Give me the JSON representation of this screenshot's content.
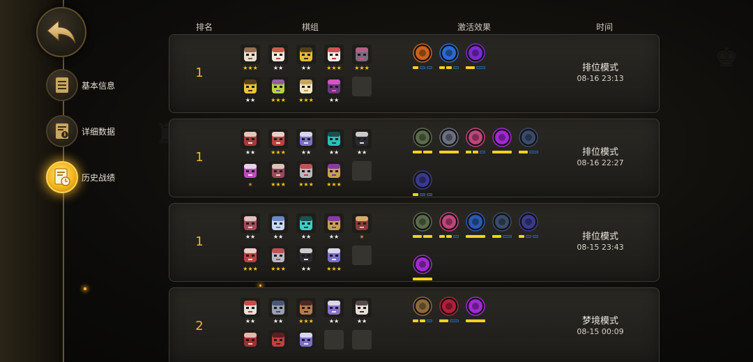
{
  "sidebar": {
    "back_icon": "back-arrow-icon",
    "items": [
      {
        "label": "基本信息",
        "icon": "document-icon"
      },
      {
        "label": "详细数据",
        "icon": "data-sheet-icon"
      },
      {
        "label": "历史战绩",
        "icon": "history-icon",
        "active": true
      }
    ]
  },
  "table": {
    "headers": {
      "rank": "排名",
      "pieces": "棋组",
      "synergy": "激活效果",
      "time": "时间"
    },
    "rows": [
      {
        "rank": "1",
        "mode": "排位模式",
        "date": "08-16 23:13",
        "pieces": [
          {
            "color": "#e8e0d0",
            "accent": "#8a5a3a",
            "stars": "★★★",
            "star_color": "gold"
          },
          {
            "color": "#f2ece0",
            "accent": "#c04830",
            "stars": "★★",
            "star_color": "white"
          },
          {
            "color": "#e9b93a",
            "accent": "#3a2a1a",
            "stars": "★★",
            "star_color": "white"
          },
          {
            "color": "#f0ece8",
            "accent": "#c83838",
            "stars": "★★★",
            "star_color": "gold"
          },
          {
            "color": "#7a6a7a",
            "accent": "#c05a8a",
            "stars": "★★★",
            "star_color": "gold"
          },
          {
            "color": "#f1c33a",
            "accent": "#3a2a1a",
            "stars": "★★",
            "star_color": "white"
          },
          {
            "color": "#b3d63a",
            "accent": "#8a4ab0",
            "stars": "★★★",
            "star_color": "gold"
          },
          {
            "color": "#f0e6c8",
            "accent": "#c09a48",
            "stars": "★★★",
            "star_color": "gold"
          },
          {
            "color": "#6a3a7a",
            "accent": "#e85ad0",
            "stars": "★★",
            "star_color": "white"
          },
          {
            "empty": true
          }
        ],
        "synergies": [
          {
            "icon": "feather-icon",
            "bg": "#c8621e",
            "level": 1,
            "max": 3
          },
          {
            "icon": "blue-feather-icon",
            "bg": "#2a6ad0",
            "level": 2,
            "max": 3
          },
          {
            "icon": "crescent-icon",
            "bg": "#7a2ad0",
            "level": 1,
            "max": 2
          }
        ]
      },
      {
        "rank": "1",
        "mode": "排位模式",
        "date": "08-16 22:27",
        "pieces": [
          {
            "color": "#a83a3a",
            "accent": "#f0e0d0",
            "stars": "★★",
            "star_color": "white"
          },
          {
            "color": "#c04040",
            "accent": "#f2e8e0",
            "stars": "★★★",
            "star_color": "gold"
          },
          {
            "color": "#7a70c8",
            "accent": "#e8e8f0",
            "stars": "★★",
            "star_color": "white"
          },
          {
            "color": "#2ac0b8",
            "accent": "#1a3a3a",
            "stars": "★★",
            "star_color": "white"
          },
          {
            "color": "#2a2a30",
            "accent": "#e8e8e8",
            "stars": "★★",
            "star_color": "white"
          },
          {
            "color": "#c04ac0",
            "accent": "#f0e8f0",
            "stars": "★",
            "star_color": "bronze"
          },
          {
            "color": "#9a4a5a",
            "accent": "#e8d8c8",
            "stars": "★★★",
            "star_color": "gold"
          },
          {
            "color": "#b8b8c0",
            "accent": "#c04040",
            "stars": "★★★",
            "star_color": "gold"
          },
          {
            "color": "#c8a050",
            "accent": "#7a2ab0",
            "stars": "★★★",
            "star_color": "gold"
          },
          {
            "empty": true
          }
        ],
        "synergies": [
          {
            "icon": "goblin-icon",
            "bg": "#5a6a4a",
            "level": 2,
            "max": 2
          },
          {
            "icon": "cross-icon",
            "bg": "#6a7080",
            "level": 1,
            "max": 1
          },
          {
            "icon": "knight-icon",
            "bg": "#c0447a",
            "level": 2,
            "max": 3
          },
          {
            "icon": "demon-icon",
            "bg": "#a02ad0",
            "level": 1,
            "max": 1
          },
          {
            "icon": "swarm-icon",
            "bg": "#3a4a6a",
            "level": 1,
            "max": 2
          },
          {
            "icon": "machine-icon",
            "bg": "#3a3a8a",
            "level": 1,
            "max": 3
          }
        ]
      },
      {
        "rank": "1",
        "mode": "排位模式",
        "date": "08-15 23:43",
        "pieces": [
          {
            "color": "#a84a5a",
            "accent": "#e8d8d0",
            "stars": "★★",
            "star_color": "white"
          },
          {
            "color": "#c8d8f0",
            "accent": "#5a7ac0",
            "stars": "★★",
            "star_color": "white"
          },
          {
            "color": "#3ad0c8",
            "accent": "#1a3a3a",
            "stars": "★★",
            "star_color": "white"
          },
          {
            "color": "#c8a050",
            "accent": "#7a2ab0",
            "stars": "★★",
            "star_color": "white"
          },
          {
            "color": "#8a3a3a",
            "accent": "#e8c070",
            "stars": "★",
            "star_color": "bronze"
          },
          {
            "color": "#c04040",
            "accent": "#f2e8e0",
            "stars": "★★★",
            "star_color": "gold"
          },
          {
            "color": "#b8b8c0",
            "accent": "#c04040",
            "stars": "★★★",
            "star_color": "gold"
          },
          {
            "color": "#2a2a30",
            "accent": "#e8e8e8",
            "stars": "★★",
            "star_color": "white"
          },
          {
            "color": "#7a70c8",
            "accent": "#e8e8f0",
            "stars": "★★★",
            "star_color": "gold"
          },
          {
            "empty": true
          }
        ],
        "synergies": [
          {
            "icon": "goblin-icon",
            "bg": "#5a6a4a",
            "level": 2,
            "max": 2
          },
          {
            "icon": "knight-icon",
            "bg": "#c0447a",
            "level": 2,
            "max": 3
          },
          {
            "icon": "dragon-icon",
            "bg": "#2a5ab0",
            "level": 1,
            "max": 1
          },
          {
            "icon": "swarm-icon",
            "bg": "#3a4a6a",
            "level": 1,
            "max": 2
          },
          {
            "icon": "machine-icon",
            "bg": "#3a3a8a",
            "level": 1,
            "max": 3
          },
          {
            "icon": "demon-icon",
            "bg": "#a02ad0",
            "level": 1,
            "max": 1
          }
        ]
      },
      {
        "rank": "2",
        "mode": "梦境模式",
        "date": "08-15 00:09",
        "pieces": [
          {
            "color": "#e8e0d8",
            "accent": "#c03030",
            "stars": "★★",
            "star_color": "white"
          },
          {
            "color": "#9aa0b0",
            "accent": "#3a4a6a",
            "stars": "★★",
            "star_color": "white"
          },
          {
            "color": "#b87a4a",
            "accent": "#3a1a1a",
            "stars": "★★★",
            "star_color": "gold"
          },
          {
            "color": "#8a70d0",
            "accent": "#e8e8f0",
            "stars": "★★",
            "star_color": "white"
          },
          {
            "color": "#e8e0d8",
            "accent": "#3a3030",
            "stars": "★★",
            "star_color": "white"
          },
          {
            "color": "#a03030",
            "accent": "#f0d0c0",
            "stars": "",
            "star_color": "white"
          },
          {
            "color": "#c04040",
            "accent": "#4a1a1a",
            "stars": "",
            "star_color": "white"
          },
          {
            "color": "#7a70c8",
            "accent": "#e8e8f0",
            "stars": "",
            "star_color": "white"
          },
          {
            "empty": true
          },
          {
            "empty": true
          }
        ],
        "synergies": [
          {
            "icon": "axe-icon",
            "bg": "#8a6a3a",
            "level": 2,
            "max": 3
          },
          {
            "icon": "shield-arc-icon",
            "bg": "#b0203a",
            "level": 1,
            "max": 2
          },
          {
            "icon": "demon-icon",
            "bg": "#a02ad0",
            "level": 1,
            "max": 1
          }
        ]
      }
    ]
  }
}
